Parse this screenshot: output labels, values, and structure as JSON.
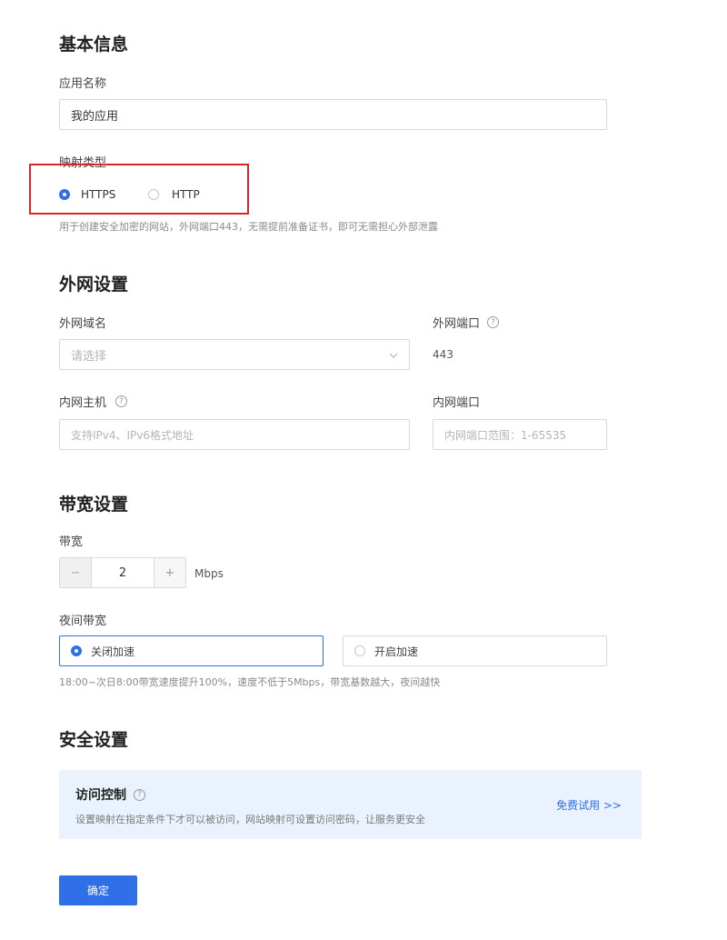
{
  "basic": {
    "title": "基本信息",
    "app_name_label": "应用名称",
    "app_name_value": "我的应用",
    "type_label": "映射类型",
    "types": [
      {
        "label": "HTTPS",
        "selected": true
      },
      {
        "label": "HTTP",
        "selected": false
      }
    ],
    "type_hint": "用于创建安全加密的网站，外网端口443，无需提前准备证书，即可无需担心外部泄露"
  },
  "external": {
    "title": "外网设置",
    "domain_label": "外网域名",
    "domain_placeholder": "请选择",
    "port_label": "外网端口",
    "port_value": "443",
    "host_label": "内网主机",
    "host_placeholder": "支持IPv4、IPv6格式地址",
    "inner_port_label": "内网端口",
    "inner_port_placeholder": "内网端口范围：1-65535"
  },
  "bandwidth": {
    "title": "带宽设置",
    "bw_label": "带宽",
    "minus": "−",
    "value": "2",
    "plus": "+",
    "unit": "Mbps",
    "night_label": "夜间带宽",
    "night_options": [
      {
        "label": "关闭加速",
        "selected": true
      },
      {
        "label": "开启加速",
        "selected": false
      }
    ],
    "night_hint": "18:00~次日8:00带宽速度提升100%，速度不低于5Mbps，带宽基数越大，夜间越快"
  },
  "security": {
    "title": "安全设置",
    "access_title": "访问控制",
    "access_desc": "设置映射在指定条件下才可以被访问，网站映射可设置访问密码，让服务更安全",
    "trial_link": "免费试用 >>"
  },
  "confirm_label": "确定",
  "colors": {
    "accent": "#2f6fe8",
    "highlight_box": "#d9262b",
    "panel_bg": "#eaf2fd"
  }
}
